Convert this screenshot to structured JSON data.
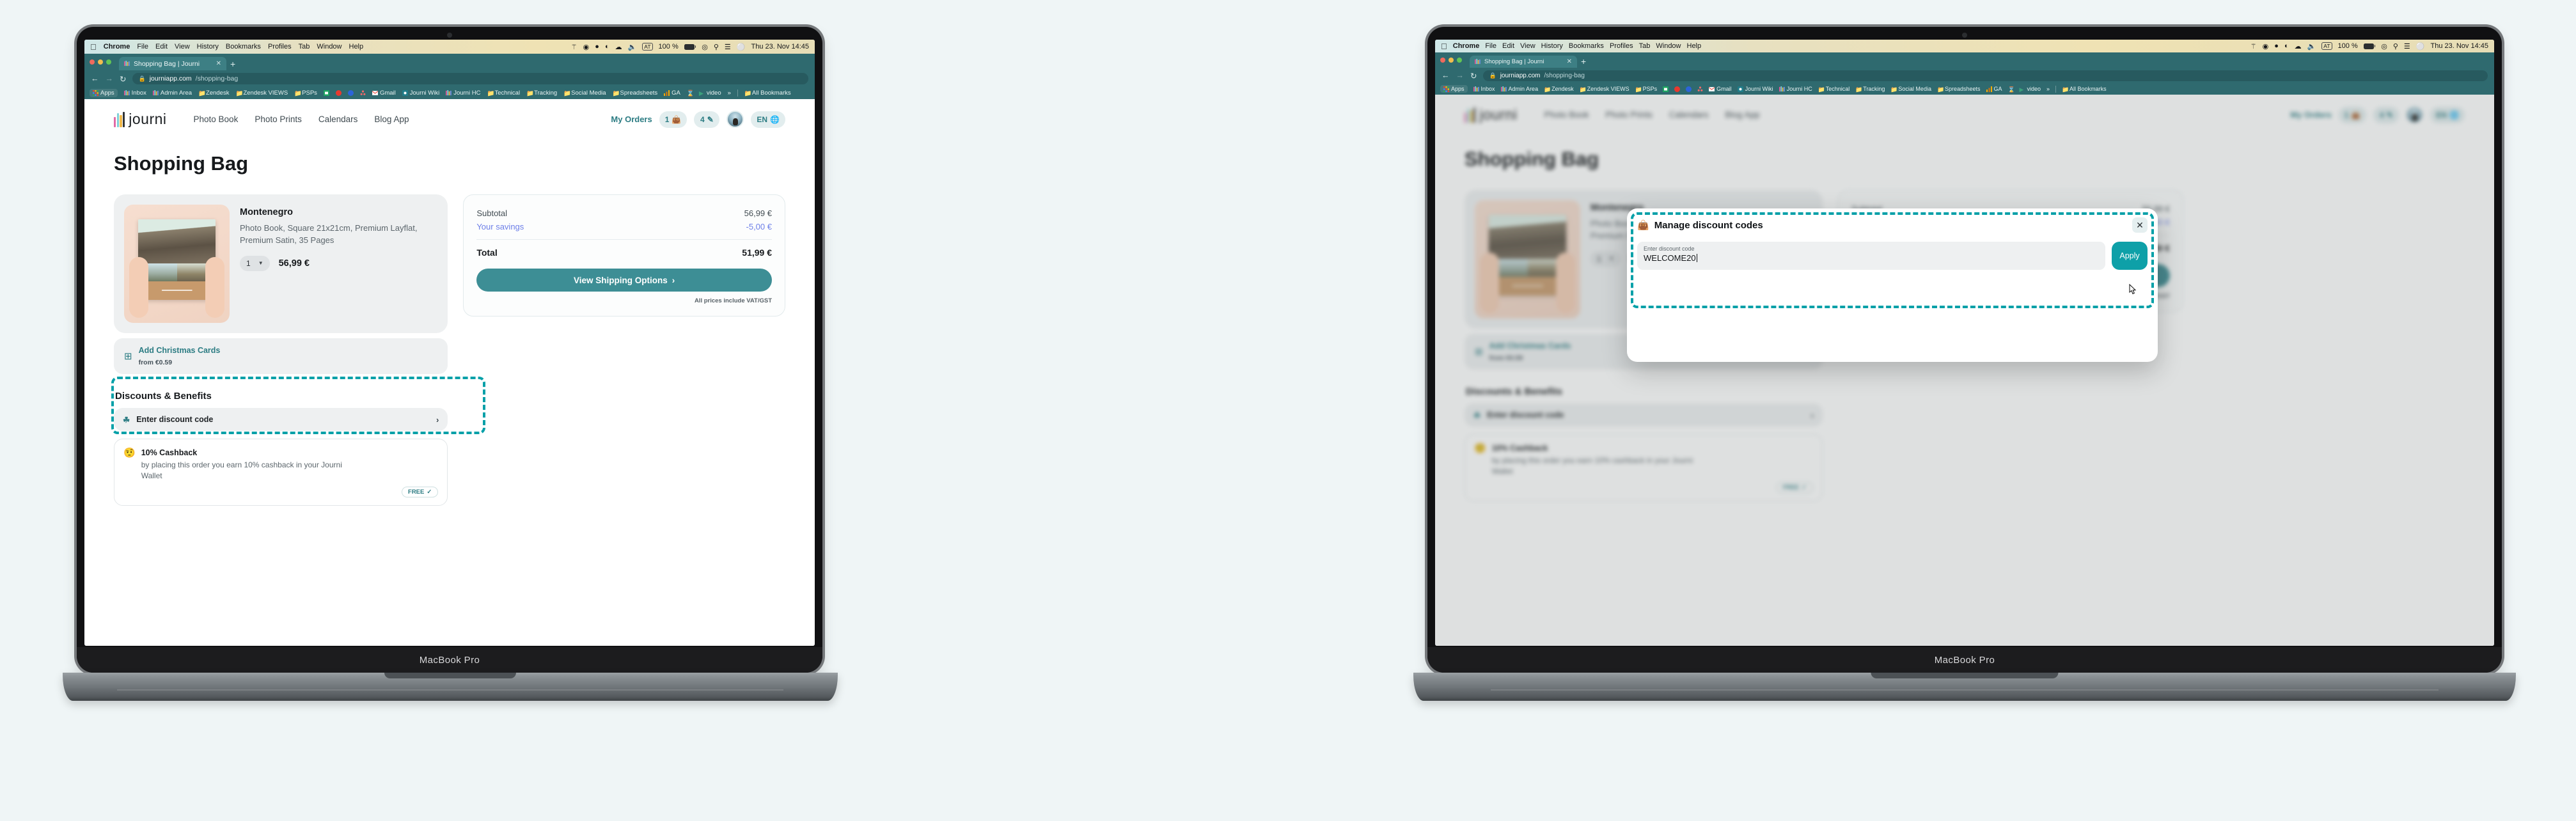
{
  "background_color": "#eff5f6",
  "accent_teal": "#3d8e95",
  "highlight_dashed": "#03a0a8",
  "laptops": [
    {
      "model_label": "MacBook Pro",
      "state": "base"
    },
    {
      "model_label": "MacBook Pro",
      "state": "modal-open"
    }
  ],
  "macos": {
    "apple_icon": "apple-icon",
    "menus": [
      "Chrome",
      "File",
      "Edit",
      "View",
      "History",
      "Bookmarks",
      "Profiles",
      "Tab",
      "Window",
      "Help"
    ],
    "status": {
      "icons": [
        "figma-icon",
        "zero-icon",
        "dropbox-icon",
        "bitwarden-icon",
        "airplay-icon",
        "volume-icon"
      ],
      "keyboard_layout": "AT",
      "battery_percent": "100 %",
      "battery_icon": "battery-charging-icon",
      "wifi_icon": "wifi-icon",
      "search_icon": "search-icon",
      "control_center_icon": "control-center-icon",
      "siri_icon": "siri-icon",
      "datetime": "Thu 23. Nov  14:45"
    }
  },
  "browser": {
    "tab": {
      "title": "Shopping Bag | Journi",
      "favicon": "journi-icon",
      "close_icon": "close-icon"
    },
    "new_tab_icon": "plus-icon",
    "nav": {
      "back_icon": "arrow-left-icon",
      "forward_icon": "arrow-right-icon",
      "reload_icon": "reload-icon"
    },
    "omnibox": {
      "lock_icon": "lock-icon",
      "host": "journiapp.com",
      "path": "/shopping-bag"
    },
    "bookmarks": [
      {
        "label": "Apps",
        "icon": "apps-grid-icon"
      },
      {
        "label": "Inbox",
        "icon": "journi-icon"
      },
      {
        "label": "Admin Area",
        "icon": "journi-icon"
      },
      {
        "label": "Zendesk",
        "icon": "folder-icon"
      },
      {
        "label": "Zendesk VIEWS",
        "icon": "folder-icon"
      },
      {
        "label": "PSPs",
        "icon": "folder-icon"
      },
      {
        "label": "",
        "icon": "sheets-icon"
      },
      {
        "label": "",
        "icon": "redbook-icon"
      },
      {
        "label": "",
        "icon": "atlas-icon"
      },
      {
        "label": "",
        "icon": "asana-icon"
      },
      {
        "label": "Gmail",
        "icon": "gmail-icon"
      },
      {
        "label": "Journi Wiki",
        "icon": "wiki-icon"
      },
      {
        "label": "Journi HC",
        "icon": "journi-icon"
      },
      {
        "label": "Technical",
        "icon": "folder-icon"
      },
      {
        "label": "Tracking",
        "icon": "folder-icon"
      },
      {
        "label": "Social Media",
        "icon": "folder-icon"
      },
      {
        "label": "Spreadsheets",
        "icon": "folder-icon"
      },
      {
        "label": "GA",
        "icon": "analytics-icon"
      },
      {
        "label": "",
        "icon": "hourglass-icon"
      },
      {
        "label": "video",
        "icon": "play-icon"
      },
      {
        "label": "»",
        "icon": "overflow-icon"
      },
      {
        "label": "All Bookmarks",
        "icon": "folder-icon"
      }
    ]
  },
  "site": {
    "logo_text": "journi",
    "logo_icon": "journi-books-icon",
    "nav": [
      "Photo Book",
      "Photo Prints",
      "Calendars",
      "Blog App"
    ],
    "header_right": {
      "my_orders": "My Orders",
      "bag_count": "1",
      "bag_icon": "shopping-bag-icon",
      "edit_count": "4",
      "edit_icon": "pencil-icon",
      "avatar": "user-avatar",
      "language": "EN",
      "globe_icon": "globe-icon"
    }
  },
  "page": {
    "title": "Shopping Bag",
    "item": {
      "name": "Montenegro",
      "description": "Photo Book, Square 21x21cm, Premium Layflat, Premium Satin, 35 Pages",
      "quantity": "1",
      "quantity_caret_icon": "chevron-down-icon",
      "price": "56,99 €",
      "thumbnail": "photo-book-preview"
    },
    "addon": {
      "icon": "add-card-icon",
      "label": "Add Christmas Cards",
      "sub": "from €0.59"
    },
    "discounts": {
      "section_title": "Discounts & Benefits",
      "enter_code_label": "Enter discount code",
      "tag_icon": "tag-icon",
      "chevron_icon": "chevron-right-icon",
      "benefit": {
        "emoji": "party-face-emoji",
        "title": "10% Cashback",
        "description": "by placing this order you earn 10% cashback in your Journi Wallet",
        "badge": "FREE",
        "badge_icon": "check-icon"
      }
    },
    "summary": {
      "subtotal_label": "Subtotal",
      "subtotal_value": "56,99 €",
      "savings_label": "Your savings",
      "savings_value": "-5,00 €",
      "total_label": "Total",
      "total_value": "51,99 €",
      "cta_label": "View Shipping Options",
      "cta_icon": "chevron-right-icon",
      "vat_note": "All prices include VAT/GST"
    }
  },
  "modal": {
    "icon": "shopping-bag-icon",
    "title": "Manage discount codes",
    "close_icon": "close-icon",
    "field_label": "Enter discount code",
    "field_value": "WELCOME20",
    "apply_label": "Apply",
    "cursor_icon": "pointer-cursor-icon"
  }
}
